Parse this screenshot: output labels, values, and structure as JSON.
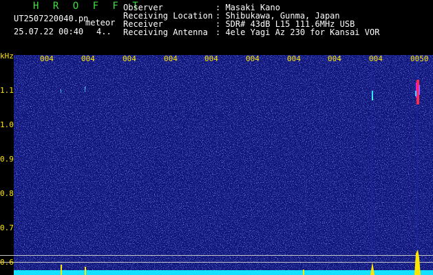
{
  "header": {
    "app_title": "H R O F F T",
    "filename": "UT2507220040.pn",
    "mode": "meteor",
    "datetime": "25.07.22 00:40",
    "count": "4..",
    "fields": [
      {
        "label": "Observer",
        "value": ": Masaki Kano"
      },
      {
        "label": "Receiving Location",
        "value": ": Shibukawa, Gunma, Japan"
      },
      {
        "label": "Receiver",
        "value": ": SDR# 43dB L15 111.6MHz USB"
      },
      {
        "label": "Receiving Antenna",
        "value": ": 4ele Yagi Az 230 for Kansai VOR"
      }
    ]
  },
  "axis": {
    "y_unit": "kHz",
    "y_ticks": [
      "1.1",
      "1.0",
      "0.9",
      "0.8",
      "0.7",
      "0.6"
    ],
    "x_ticks": [
      "004",
      "004",
      "004",
      "004",
      "004",
      "004",
      "004",
      "004",
      "004",
      "0050"
    ]
  },
  "colors": {
    "background": "#000000",
    "plot": "#0f157a",
    "title": "#3fe03f",
    "labels": "#ffe600",
    "baseline": "#14e0ff"
  }
}
